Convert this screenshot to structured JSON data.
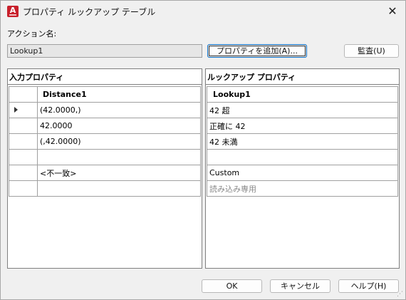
{
  "window": {
    "title": "プロパティ ルックアップ テーブル",
    "app_icon_letter": "A",
    "close_glyph": "✕"
  },
  "action": {
    "label": "アクション名:",
    "value": "Lookup1"
  },
  "buttons": {
    "add_property": "プロパティを追加(A)...",
    "audit": "監査(U)",
    "ok": "OK",
    "cancel": "キャンセル",
    "help": "ヘルプ(H)"
  },
  "input_panel": {
    "title": "入力プロパティ",
    "column_header": "Distance1",
    "rows": [
      "(42.0000,)",
      "42.0000",
      "(,42.0000)",
      "",
      "<不一致>",
      ""
    ],
    "current_row_index": 0
  },
  "lookup_panel": {
    "title": "ルックアップ プロパティ",
    "column_header": "Lookup1",
    "rows": [
      "42 超",
      "正確に 42",
      "42 未満",
      "",
      "Custom",
      "読み込み専用"
    ]
  }
}
